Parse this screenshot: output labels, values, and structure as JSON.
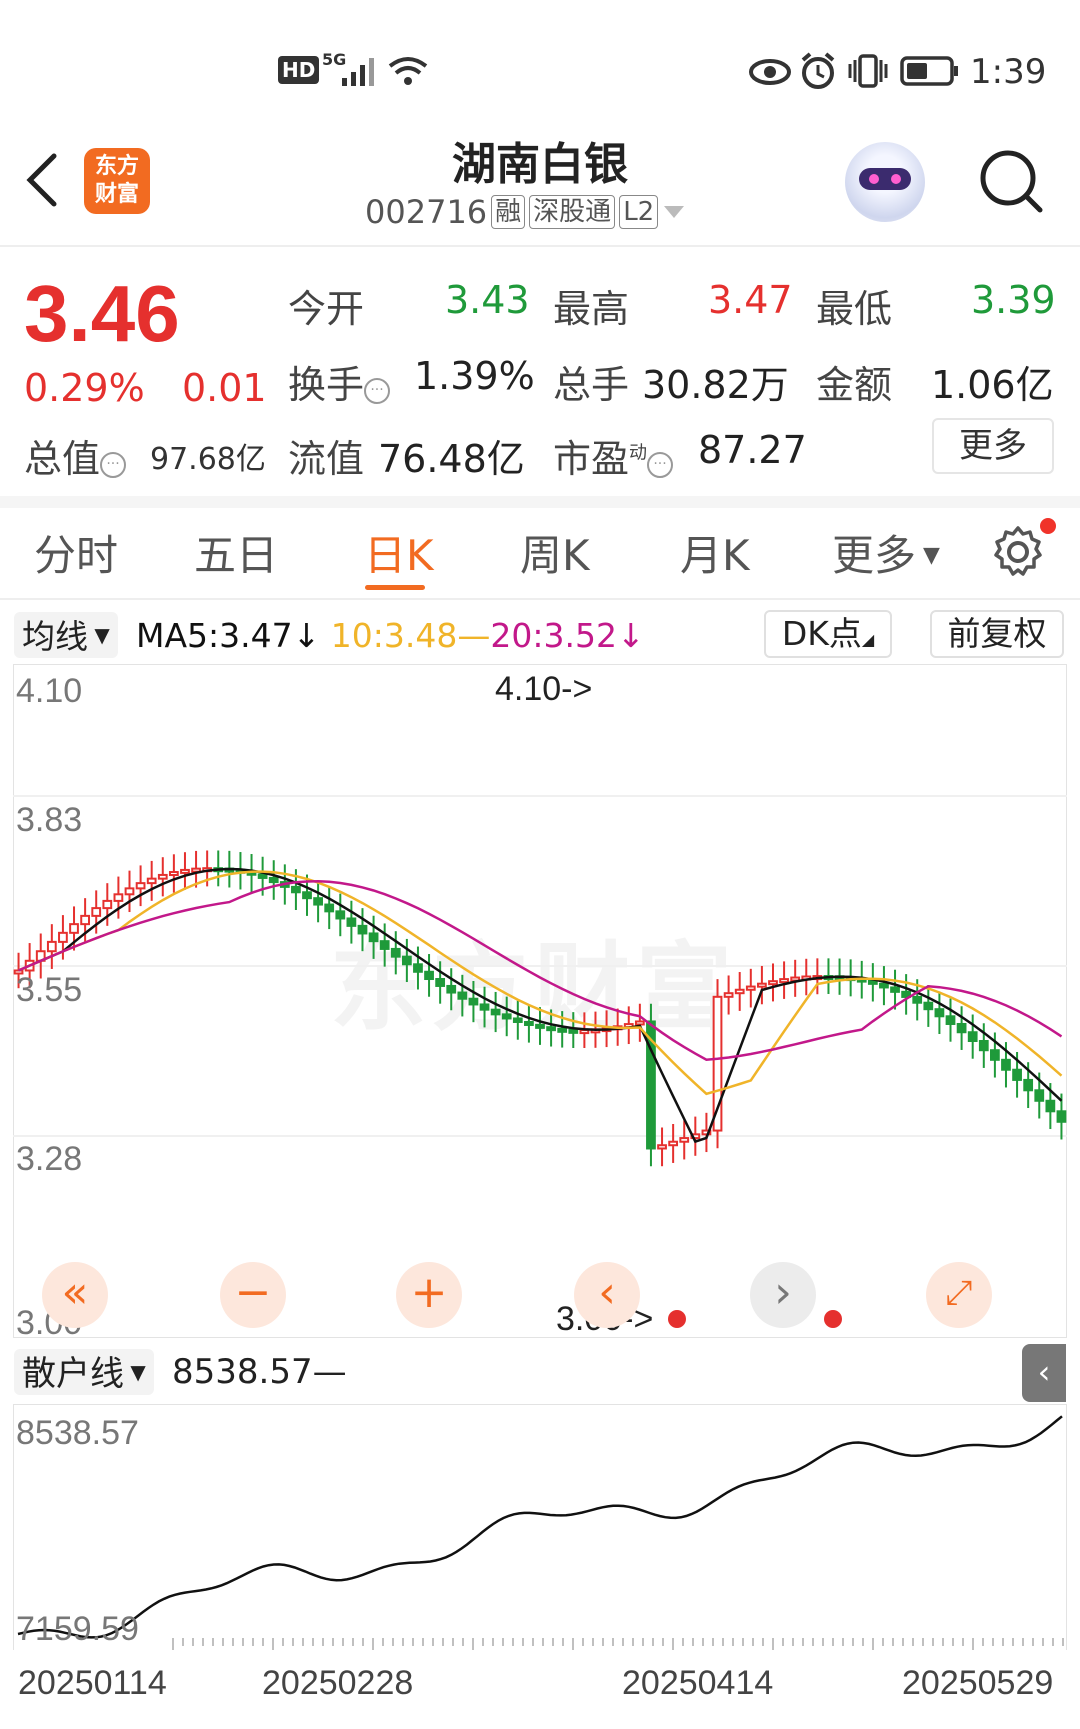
{
  "status_bar": {
    "network": "HD",
    "signal": "5G",
    "time": "1:39"
  },
  "header": {
    "logo_line1": "东方",
    "logo_line2": "财富",
    "stock_name": "湖南白银",
    "stock_code": "002716",
    "tags": [
      "融",
      "深股通",
      "L2"
    ]
  },
  "quote": {
    "price": "3.46",
    "change_pct": "0.29%",
    "change": "0.01",
    "open_label": "今开",
    "open": "3.43",
    "high_label": "最高",
    "high": "3.47",
    "low_label": "最低",
    "low": "3.39",
    "turnover_label": "换手",
    "turnover": "1.39%",
    "volume_label": "总手",
    "volume": "30.82万",
    "amount_label": "金额",
    "amount": "1.06亿",
    "mcap_label": "总值",
    "mcap": "97.68亿",
    "float_label": "流值",
    "float": "76.48亿",
    "pe_label": "市盈",
    "pe_sup": "动",
    "pe": "87.27",
    "more_label": "更多"
  },
  "tabs": {
    "items": [
      "分时",
      "五日",
      "日K",
      "周K",
      "月K",
      "更多"
    ],
    "active": "日K"
  },
  "ma_row": {
    "selector_label": "均线",
    "ma5": "MA5:3.47",
    "ma10": "10:3.48",
    "ma20": "20:3.52",
    "dk_label": "DK点",
    "adjust_label": "前复权"
  },
  "colors": {
    "up": "#e5302e",
    "down": "#1f9a3a",
    "ma5": "#111111",
    "ma10": "#f0b429",
    "ma20": "#c2188a",
    "accent": "#f26b21"
  },
  "chart_data": {
    "type": "candlestick",
    "y_ticks": [
      "4.10",
      "3.83",
      "3.55",
      "3.28",
      "3.00"
    ],
    "ylim": [
      3.0,
      4.1
    ],
    "max_marker": "4.10->",
    "min_marker": "3.00->"
  },
  "indicator": {
    "selector_label": "散户线",
    "value_text": "8538.57—",
    "y_ticks": [
      "8538.57",
      "7159.59"
    ],
    "x_labels": [
      "20250114",
      "20250228",
      "20250414",
      "20250529"
    ]
  },
  "watermark": "东方财富"
}
